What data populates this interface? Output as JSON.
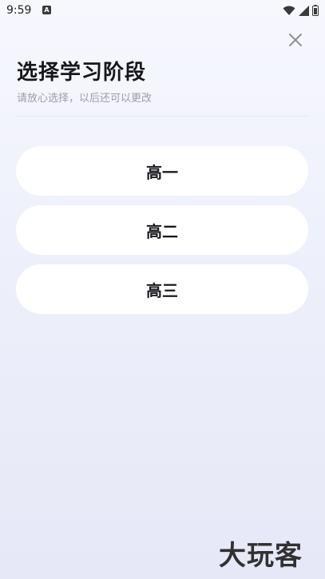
{
  "status_bar": {
    "time": "9:59",
    "badge": "A"
  },
  "header": {
    "title": "选择学习阶段",
    "subtitle": "请放心选择，以后还可以更改"
  },
  "options": [
    {
      "label": "高一"
    },
    {
      "label": "高二"
    },
    {
      "label": "高三"
    }
  ],
  "watermark": "大玩客",
  "icons": {
    "close": "close-icon",
    "wifi": "wifi-icon",
    "signal": "signal-icon",
    "battery": "battery-icon"
  },
  "colors": {
    "background_top": "#f7f8fe",
    "background_bottom": "#e6e8f7",
    "option_bg": "#ffffff",
    "title": "#16161c",
    "subtitle": "#9b9ea8"
  }
}
